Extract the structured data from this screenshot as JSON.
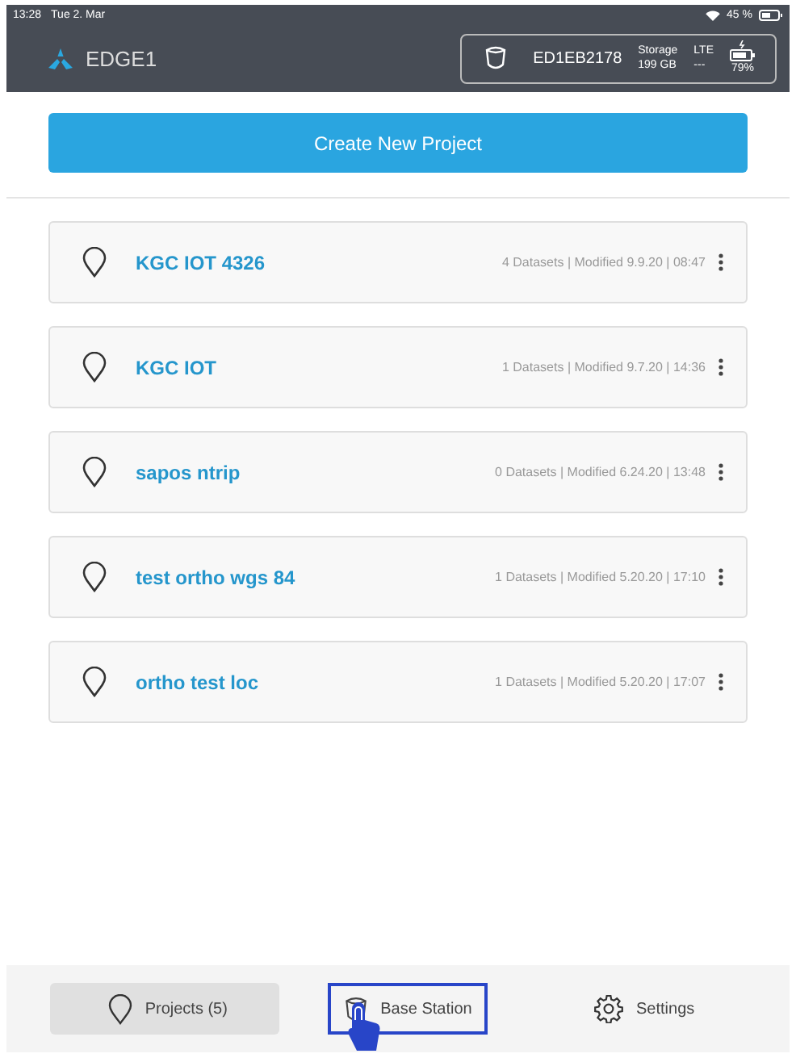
{
  "status_bar": {
    "time": "13:28",
    "date": "Tue 2. Mar",
    "battery": "45 %"
  },
  "header": {
    "title": "EDGE1",
    "device": {
      "id": "ED1EB2178",
      "storage_label": "Storage",
      "storage_value": "199 GB",
      "network_label": "LTE",
      "network_value": "---",
      "battery": "79%"
    }
  },
  "create_button": "Create New Project",
  "projects": [
    {
      "name": "KGC IOT 4326",
      "meta": "4 Datasets | Modified 9.9.20 | 08:47"
    },
    {
      "name": "KGC IOT",
      "meta": "1 Datasets | Modified 9.7.20 | 14:36"
    },
    {
      "name": "sapos ntrip",
      "meta": "0 Datasets | Modified 6.24.20 | 13:48"
    },
    {
      "name": "test ortho wgs 84",
      "meta": "1 Datasets | Modified 5.20.20 | 17:10"
    },
    {
      "name": "ortho test loc",
      "meta": "1 Datasets | Modified 5.20.20 | 17:07"
    }
  ],
  "bottom_nav": [
    {
      "kind": "projects",
      "label": "Projects (5)",
      "selected": true,
      "highlighted": false
    },
    {
      "kind": "base",
      "label": "Base Station",
      "selected": false,
      "highlighted": true
    },
    {
      "kind": "settings",
      "label": "Settings",
      "selected": false,
      "highlighted": false
    }
  ]
}
